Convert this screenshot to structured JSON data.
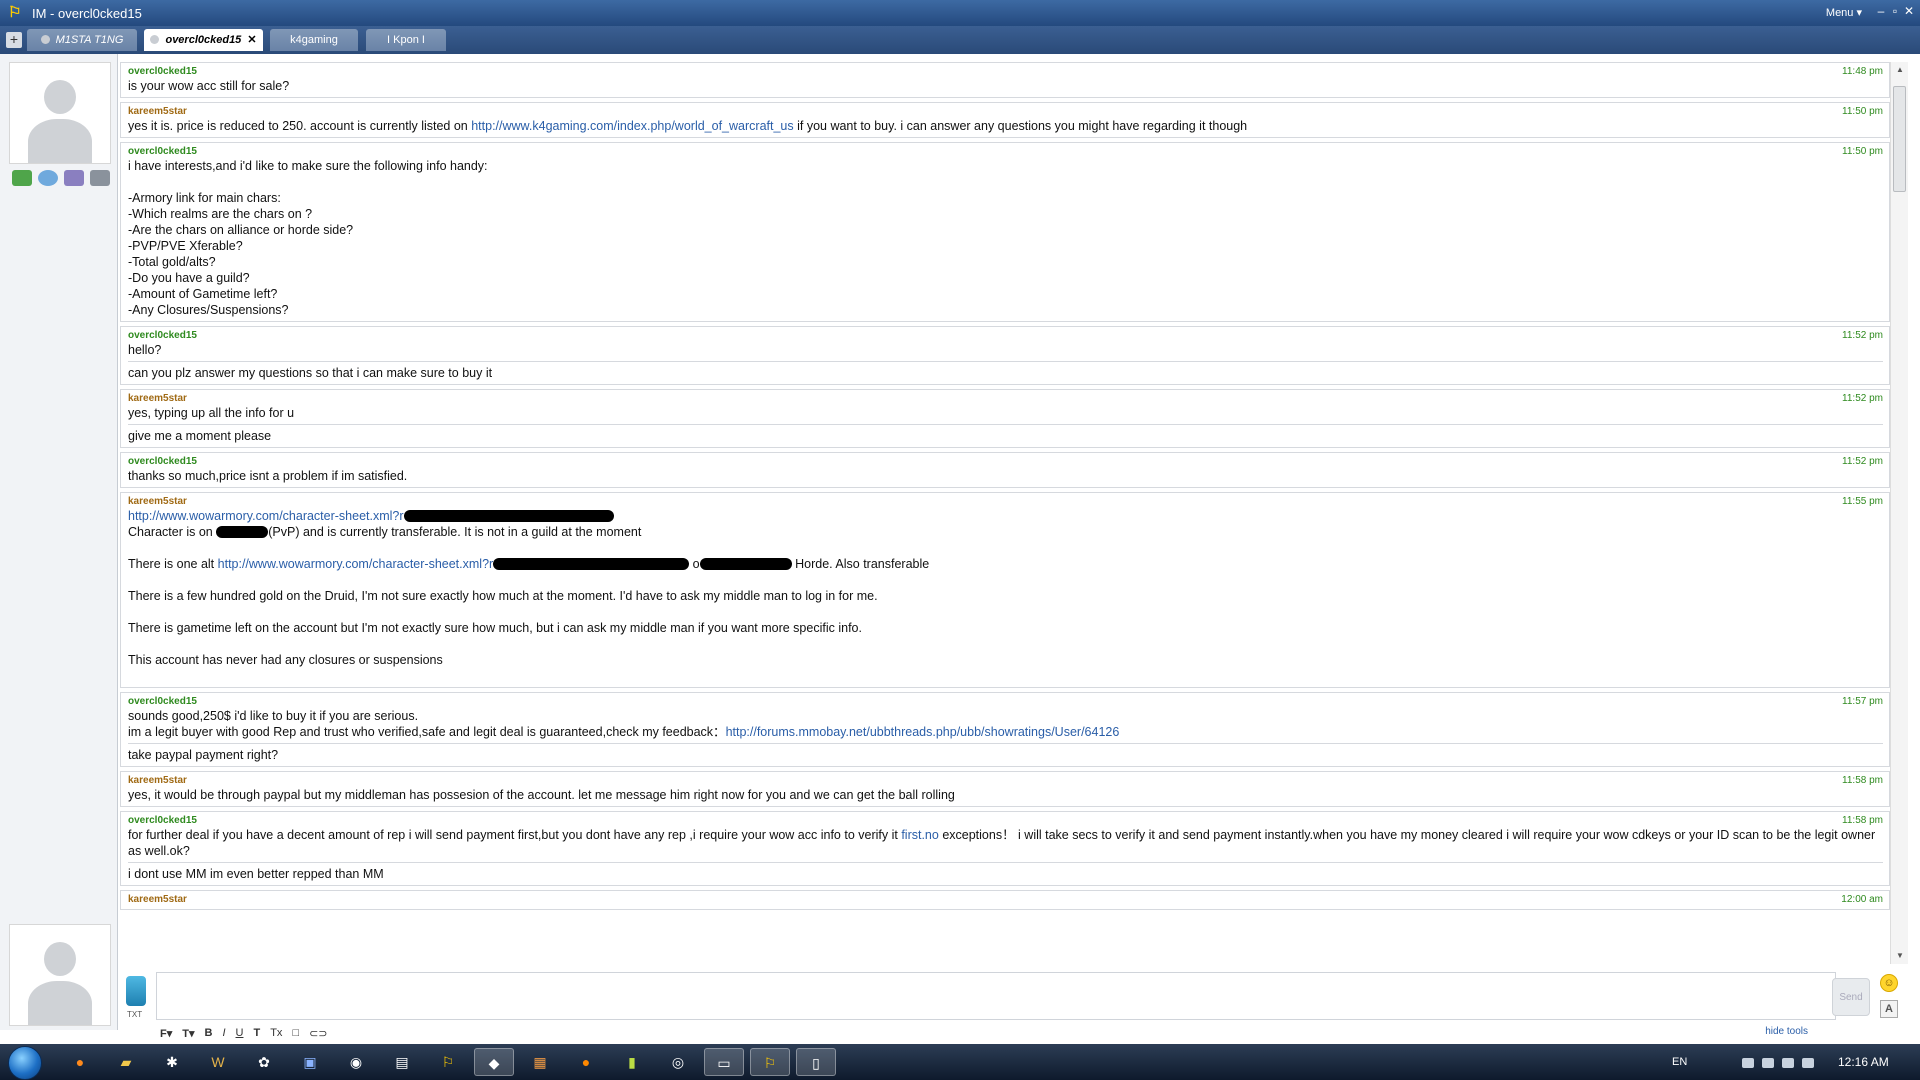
{
  "window": {
    "title": "IM - overcl0cked15",
    "menu_label": "Menu ▾",
    "controls": {
      "minimize": "–",
      "restore": "▫",
      "close": "✕"
    }
  },
  "tabs": [
    {
      "label": "M1STA T1NG",
      "active": false
    },
    {
      "label": "overcl0cked15",
      "active": true,
      "close": "✕"
    },
    {
      "label": "k4gaming",
      "active": false
    },
    {
      "label": "I Kpon I",
      "active": false
    }
  ],
  "messages": [
    {
      "sender": "overcl0cked15",
      "time": "11:48 pm",
      "lines": [
        "is your wow acc still for sale?"
      ]
    },
    {
      "sender": "kareem5star",
      "time": "11:50 pm",
      "l1a": "yes it is. price is reduced to 250. account is currently listed on ",
      "l1link": "http://www.k4gaming.com/index.php/world_of_warcraft_us",
      "l1b": " if you want to buy. i can answer any questions you might have regarding it though"
    },
    {
      "sender": "overcl0cked15",
      "time": "11:50 pm",
      "text": "i have interests,and i'd like to make sure the following info handy:\n\n-Armory link for main chars:\n-Which realms are the chars on ?\n-Are the chars on alliance or horde side?\n-PVP/PVE Xferable?\n-Total gold/alts?\n-Do you have a guild?\n-Amount of Gametime left?\n-Any Closures/Suspensions?"
    },
    {
      "sender": "overcl0cked15",
      "time": "11:52 pm",
      "lines": [
        "hello?",
        "can you plz answer my questions so that i can make sure to buy it"
      ]
    },
    {
      "sender": "kareem5star",
      "time": "11:52 pm",
      "lines": [
        "yes, typing up all the info for u",
        "give me a moment please"
      ]
    },
    {
      "sender": "overcl0cked15",
      "time": "11:52 pm",
      "lines": [
        "thanks so much,price isnt a problem if im satisfied."
      ]
    },
    {
      "sender": "kareem5star",
      "time": "11:55 pm",
      "armory_link": "http://www.wowarmory.com/character-sheet.xml?r",
      "char_a": "Character is on ",
      "char_b": "(PvP) and is currently transferable. It is not in a guild at the moment",
      "alt_a": "There is one alt ",
      "alt_link": "http://www.wowarmory.com/character-sheet.xml?r",
      "alt_b": " o",
      "alt_c": " Horde. Also transferable",
      "gold": "There is a few hundred gold on the Druid, I'm not sure exactly how much at the moment. I'd have to ask my middle man to log in for me.",
      "gametime": "There is gametime left on the account but I'm not exactly sure how much, but i can ask my middle man if you want more specific info.",
      "closures": "This account has never had any closures or suspensions"
    },
    {
      "sender": "overcl0cked15",
      "time": "11:57 pm",
      "l1": "sounds good,250$ i'd like to buy it if you are serious.",
      "l2a": "im a legit buyer with good Rep and trust who verified,safe and legit deal is guaranteed,check my feedback：",
      "l2link": "http://forums.mmobay.net/ubbthreads.php/ubb/showratings/User/64126",
      "l3": "take paypal payment right?"
    },
    {
      "sender": "kareem5star",
      "time": "11:58 pm",
      "lines": [
        "yes, it would be through paypal but my middleman has possesion of the account. let me message him right now for you and we can get the ball rolling"
      ]
    },
    {
      "sender": "overcl0cked15",
      "time": "11:58 pm",
      "l1a": "for further deal if you have a decent amount of rep i will send payment first,but you dont have any rep ,i require your wow acc info to verify it ",
      "l1link": "first.no",
      "l1b": " exceptions！ i will take secs to verify it and send payment instantly.when you have my money cleared i will require your wow cdkeys or your ID scan to be the legit owner as well.ok?",
      "l2": "i dont use MM im even better repped than MM"
    },
    {
      "sender": "kareem5star",
      "time": "12:00 am"
    }
  ],
  "input": {
    "txt_label": "TXT",
    "send_label": "Send",
    "smiley": "☺",
    "font_button": "A",
    "placeholder": ""
  },
  "format_toolbar": {
    "font": "F▾",
    "size": "T▾",
    "bold": "B",
    "italic": "I",
    "underline": "U",
    "color": "T",
    "clear": "Tx",
    "box": "□",
    "link": "⊂⊃",
    "hide_tools": "hide tools"
  },
  "taskbar": {
    "language": "EN",
    "clock": "12:16 AM",
    "apps": [
      "firefox-icon",
      "folder-icon",
      "app-icon-3",
      "wow-icon",
      "app-icon-5",
      "app-icon-6",
      "app-icon-7",
      "app-icon-8",
      "aim-icon",
      "app-icon-10",
      "app-icon-11",
      "app-icon-12",
      "app-icon-13",
      "app-icon-14",
      "app-icon-15",
      "app-icon-16",
      "aim-running-icon",
      "app-icon-18"
    ]
  },
  "colors": {
    "green_sender": "#2e8a1e",
    "brown_sender": "#a06a14",
    "link": "#2a5ea8",
    "titlebar": "#24497e"
  }
}
